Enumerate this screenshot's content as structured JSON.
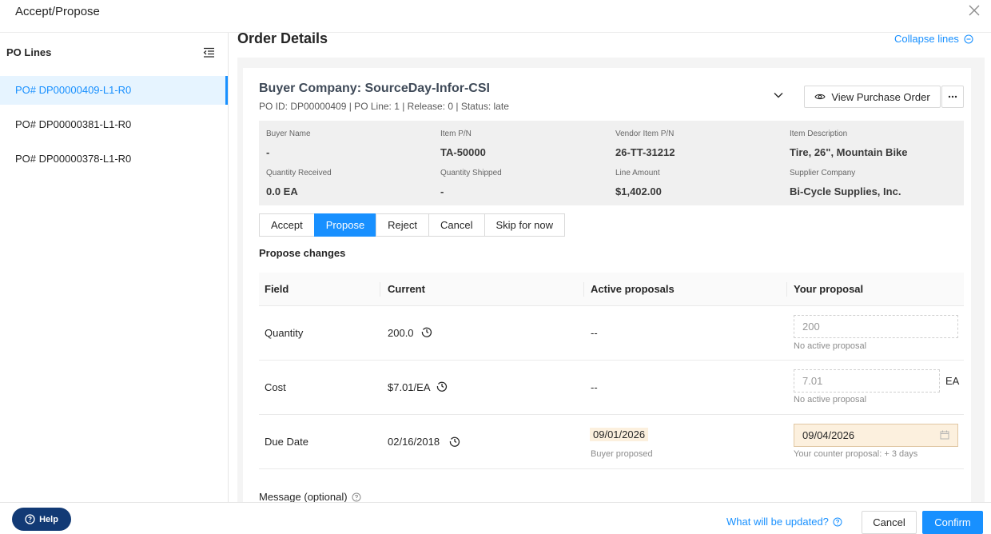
{
  "dialog": {
    "title": "Accept/Propose"
  },
  "sidebar": {
    "title": "PO Lines",
    "items": [
      {
        "label": "PO# DP00000409-L1-R0"
      },
      {
        "label": "PO# DP00000381-L1-R0"
      },
      {
        "label": "PO# DP00000378-L1-R0"
      }
    ]
  },
  "main": {
    "title": "Order Details",
    "collapse_label": "Collapse lines"
  },
  "order": {
    "buyer": "Buyer Company: SourceDay-Infor-CSI",
    "po_info": "PO ID: DP00000409 | PO Line: 1 | Release: 0 | Status: late",
    "view_po_label": "View Purchase Order",
    "fields": [
      {
        "label": "Buyer Name",
        "value": "-"
      },
      {
        "label": "Item P/N",
        "value": "TA-50000"
      },
      {
        "label": "Vendor Item P/N",
        "value": "26-TT-31212"
      },
      {
        "label": "Item Description",
        "value": "Tire, 26\", Mountain Bike"
      },
      {
        "label": "Quantity Received",
        "value": "0.0 EA"
      },
      {
        "label": "Quantity Shipped",
        "value": "-"
      },
      {
        "label": "Line Amount",
        "value": "$1,402.00"
      },
      {
        "label": "Supplier Company",
        "value": "Bi-Cycle Supplies, Inc."
      }
    ]
  },
  "actions": [
    "Accept",
    "Propose",
    "Reject",
    "Cancel",
    "Skip for now"
  ],
  "propose": {
    "title": "Propose changes",
    "headers": [
      "Field",
      "Current",
      "Active proposals",
      "Your proposal"
    ],
    "rows": [
      {
        "field": "Quantity",
        "current": "200.0",
        "active": "--",
        "proposal": "200",
        "hint": "No active proposal"
      },
      {
        "field": "Cost",
        "current": "$7.01/EA",
        "active": "--",
        "proposal": "7.01",
        "unit": "EA",
        "hint": "No active proposal"
      },
      {
        "field": "Due Date",
        "current": "02/16/2018",
        "active": "09/01/2026",
        "active_hint": "Buyer proposed",
        "proposal": "09/04/2026",
        "hint": "Your counter proposal: + 3 days"
      }
    ],
    "message_label": "Message (optional)"
  },
  "footer": {
    "help_label": "Help",
    "what_label": "What will be updated?",
    "cancel_label": "Cancel",
    "confirm_label": "Confirm"
  },
  "colors": {
    "accent": "#1890ff",
    "help_bg": "#123a75",
    "highlight": "#fcf0de"
  }
}
